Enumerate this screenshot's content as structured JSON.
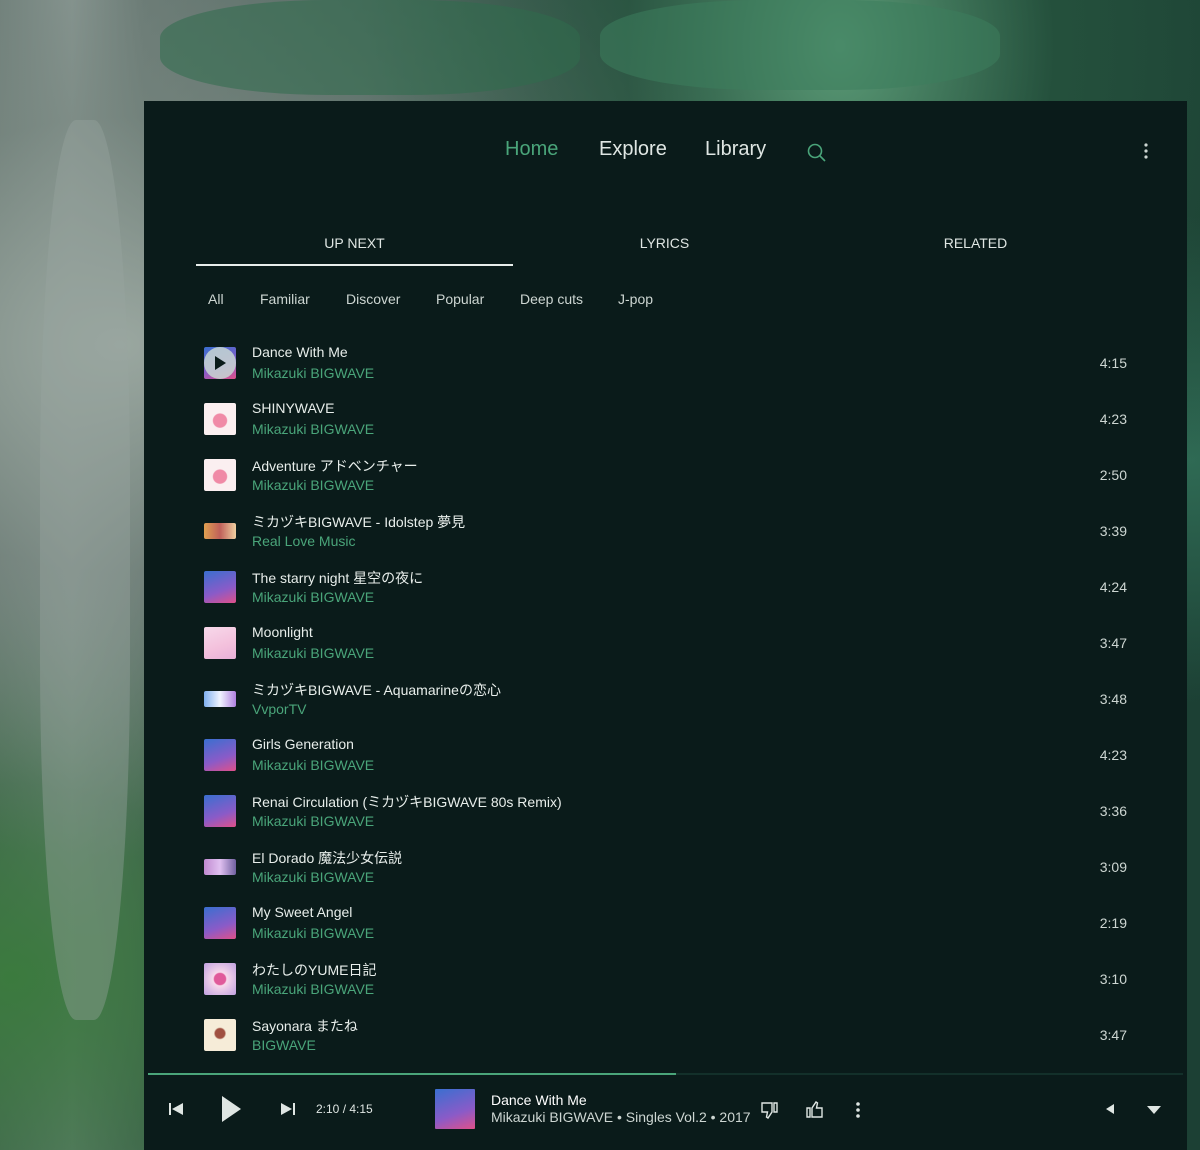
{
  "nav": {
    "home": "Home",
    "explore": "Explore",
    "library": "Library",
    "search_icon": "search-icon",
    "menu_icon": "more-vert-icon",
    "accent_color": "#4aa57a"
  },
  "tabs": {
    "up_next": "UP NEXT",
    "lyrics": "LYRICS",
    "related": "RELATED",
    "selected": "UP NEXT"
  },
  "chips": [
    "All",
    "Familiar",
    "Discover",
    "Popular",
    "Deep cuts",
    "J-pop"
  ],
  "queue": [
    {
      "title": "Dance With Me",
      "artist": "Mikazuki BIGWAVE",
      "duration": "4:15",
      "playing": true
    },
    {
      "title": "SHINYWAVE",
      "artist": "Mikazuki BIGWAVE",
      "duration": "4:23"
    },
    {
      "title": "Adventure アドベンチャー",
      "artist": "Mikazuki BIGWAVE",
      "duration": "2:50"
    },
    {
      "title": "ミカヅキBIGWAVE - Idolstep 夢見",
      "artist": "Real Love Music",
      "duration": "3:39"
    },
    {
      "title": "The starry night 星空の夜に",
      "artist": "Mikazuki BIGWAVE",
      "duration": "4:24"
    },
    {
      "title": "Moonlight",
      "artist": "Mikazuki BIGWAVE",
      "duration": "3:47"
    },
    {
      "title": "ミカヅキBIGWAVE - Aquamarineの恋心",
      "artist": "VvporTV",
      "duration": "3:48"
    },
    {
      "title": "Girls Generation",
      "artist": "Mikazuki BIGWAVE",
      "duration": "4:23"
    },
    {
      "title": "Renai Circulation (ミカヅキBIGWAVE 80s Remix)",
      "artist": "Mikazuki BIGWAVE",
      "duration": "3:36"
    },
    {
      "title": "El Dorado 魔法少女伝説",
      "artist": "Mikazuki BIGWAVE",
      "duration": "3:09"
    },
    {
      "title": "My Sweet Angel",
      "artist": "Mikazuki BIGWAVE",
      "duration": "2:19"
    },
    {
      "title": "わたしのYUME日記",
      "artist": "Mikazuki BIGWAVE",
      "duration": "3:10"
    },
    {
      "title": "Sayonara またね",
      "artist": "BIGWAVE",
      "duration": "3:47"
    }
  ],
  "player": {
    "time": "2:10 / 4:15",
    "progress_fraction": 0.51,
    "title": "Dance With Me",
    "subtitle": "Mikazuki BIGWAVE • Singles Vol.2 • 2017",
    "icons": [
      "skip-previous-icon",
      "play-icon",
      "skip-next-icon",
      "thumb-down-icon",
      "thumb-up-icon",
      "more-vert-icon",
      "volume-icon",
      "expand-icon"
    ]
  }
}
